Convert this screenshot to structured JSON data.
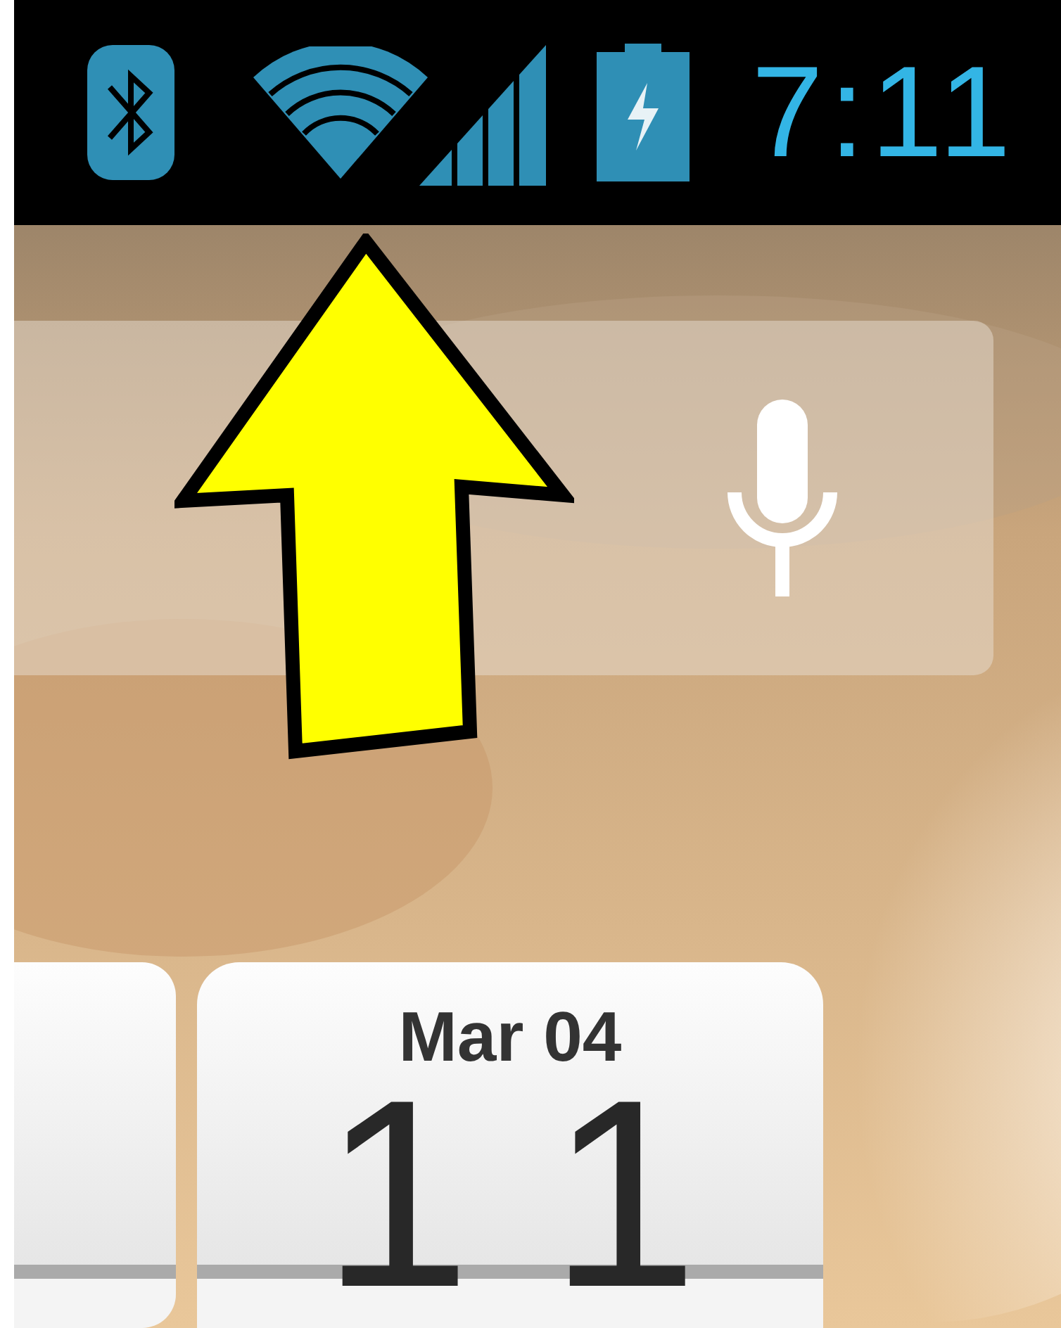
{
  "status_bar": {
    "time": "7:11"
  },
  "clock_widget": {
    "date": "Mar 04",
    "hour": "11"
  }
}
